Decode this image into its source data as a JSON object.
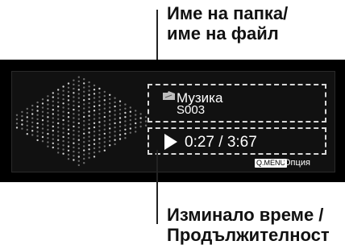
{
  "callouts": {
    "top_line1": "Име на папка/",
    "top_line2": "име на файл",
    "bottom_line1": "Изминало време /",
    "bottom_line2": "Продължителност"
  },
  "player": {
    "folder_name": "Музика",
    "file_name": "S003",
    "time": "0:27 / 3:67",
    "qmenu_key": "Q.MENU",
    "option_label": "Опция"
  },
  "icons": {
    "music": "music-folder-icon",
    "play": "play-icon"
  },
  "colors": {
    "screen_bg": "#000000",
    "text": "#ffffff",
    "dots": "#8a8a8a"
  }
}
